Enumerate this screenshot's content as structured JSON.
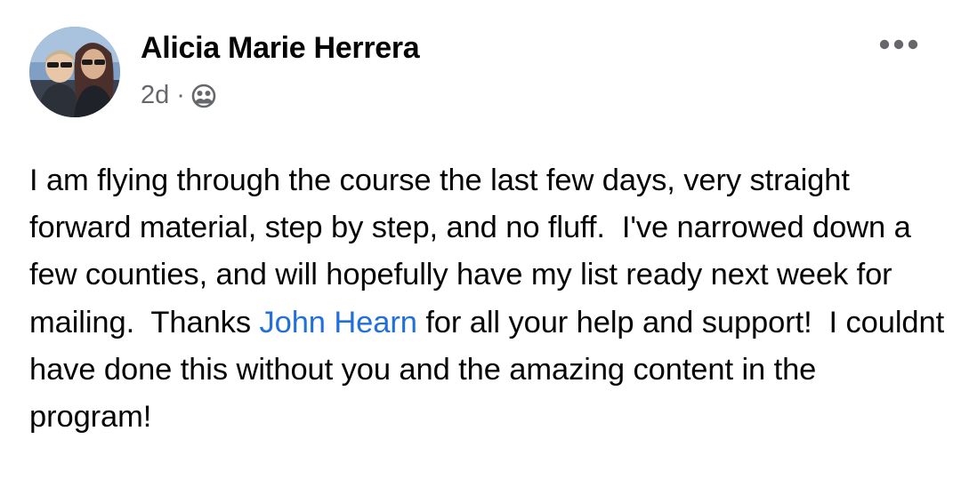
{
  "post": {
    "author": "Alicia Marie Herrera",
    "time": "2d",
    "separator": "·",
    "audience_icon": "friends-icon",
    "more_icon": "more-horizontal-icon",
    "body": {
      "text_before": "I am flying through the course the last few days, very straight forward material, step by step, and no fluff.  I've narrowed down a few counties, and will hopefully have my list ready next week for mailing.  Thanks ",
      "mention": "John Hearn",
      "text_after": " for all your help and support!  I couldnt have done this without you and the amazing content in the program!"
    }
  },
  "colors": {
    "text": "#050505",
    "secondary": "#65676b",
    "link": "#216fdb"
  }
}
